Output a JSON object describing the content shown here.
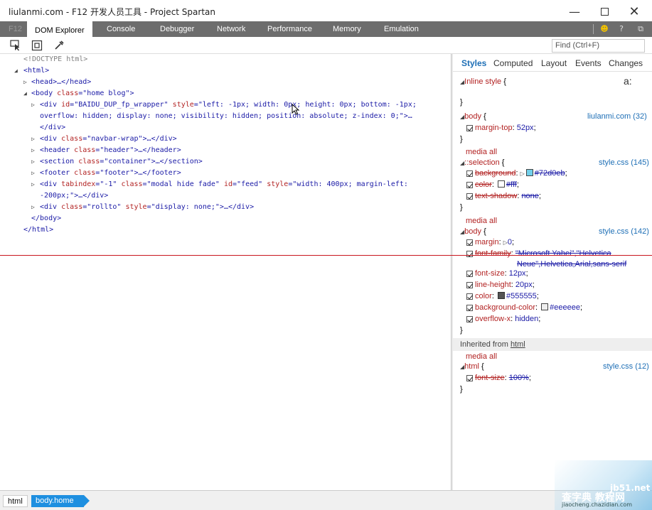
{
  "window": {
    "title": "liulanmi.com - F12 开发人员工具 - Project Spartan"
  },
  "tabs": [
    "F12",
    "DOM Explorer",
    "Console",
    "Debugger",
    "Network",
    "Performance",
    "Memory",
    "Emulation"
  ],
  "search": {
    "placeholder": "Find (Ctrl+F)"
  },
  "dom": {
    "doctype": "<!DOCTYPE html>",
    "html_open": "<html>",
    "head": "<head>…</head>",
    "body_tag": "<body ",
    "body_attr": "class",
    "body_val": "\"home blog\"",
    "body_close": ">",
    "div1_pre": "<div ",
    "div1_a1": "id",
    "div1_v1": "\"BAIDU_DUP_fp_wrapper\"",
    "div1_a2": "style",
    "div1_v2": "\"left: -1px; width: 0px; height: 0px; bottom: -1px;",
    "div1_v2b": "overflow: hidden; display: none; visibility: hidden; position: absolute; z-index: 0;\">…",
    "div1_end": "</div>",
    "navbar_pre": "<div ",
    "navbar_a": "class",
    "navbar_v": "\"navbar-wrap\"",
    "navbar_end": ">…</div>",
    "header_pre": "<header ",
    "header_a": "class",
    "header_v": "\"header\"",
    "header_end": ">…</header>",
    "section_pre": "<section ",
    "section_a": "class",
    "section_v": "\"container\"",
    "section_end": ">…</section>",
    "footer_pre": "<footer ",
    "footer_a": "class",
    "footer_v": "\"footer\"",
    "footer_end": ">…</footer>",
    "modal_pre": "<div ",
    "modal_a1": "tabindex",
    "modal_v1": "\"-1\"",
    "modal_a2": "class",
    "modal_v2": "\"modal hide fade\"",
    "modal_a3": "id",
    "modal_v3": "\"feed\"",
    "modal_a4": "style",
    "modal_v4": "\"width: 400px; margin-left:",
    "modal_v4b": "-200px;\">…</div>",
    "rollto_pre": "<div ",
    "rollto_a1": "class",
    "rollto_v1": "\"rollto\"",
    "rollto_a2": "style",
    "rollto_v2": "\"display: none;\"",
    "rollto_end": ">…</div>",
    "body_end": "</body>",
    "html_end": "</html>"
  },
  "styles": {
    "tabs": [
      "Styles",
      "Computed",
      "Layout",
      "Events",
      "Changes"
    ],
    "inline_label": "Inline style",
    "brace_open": "{",
    "brace_close": "}",
    "font_btn": "a:",
    "rule1": {
      "selector": "body",
      "source": "liulanmi.com (32)",
      "props": [
        {
          "name": "margin-top",
          "value": "52px"
        }
      ]
    },
    "media_all": "media all",
    "rule2": {
      "selector": "::selection",
      "source": "style.css (145)",
      "props": [
        {
          "name": "background",
          "value": "#72d0eb"
        },
        {
          "name": "color",
          "value": "#fff"
        },
        {
          "name": "text-shadow",
          "value": "none"
        }
      ]
    },
    "rule3": {
      "selector": "body",
      "source": "style.css (142)",
      "props": [
        {
          "name": "margin",
          "value": "0"
        },
        {
          "name": "font-family",
          "value": "\"Microsoft Yahei\",\"Helvetica",
          "value2": "Neue\",Helvetica,Arial,sans-serif"
        },
        {
          "name": "font-size",
          "value": "12px"
        },
        {
          "name": "line-height",
          "value": "20px"
        },
        {
          "name": "color",
          "value": "#555555"
        },
        {
          "name": "background-color",
          "value": "#eeeeee"
        },
        {
          "name": "overflow-x",
          "value": "hidden"
        }
      ]
    },
    "inherited_label": "Inherited from",
    "inherited_el": "html",
    "rule4": {
      "selector": "html",
      "source": "style.css (12)",
      "props": [
        {
          "name": "font-size",
          "value": "100%"
        }
      ]
    }
  },
  "breadcrumbs": [
    "html",
    "body.home"
  ],
  "watermark": {
    "line1": "jb51.net",
    "line2": "查字典 教程网",
    "line3": "jiaocheng.chazidian.com"
  },
  "colors": {
    "accent": "#1e8fe0",
    "selection": "#72d0eb",
    "white": "#ffffff",
    "text": "#555555",
    "bg": "#eeeeee"
  }
}
